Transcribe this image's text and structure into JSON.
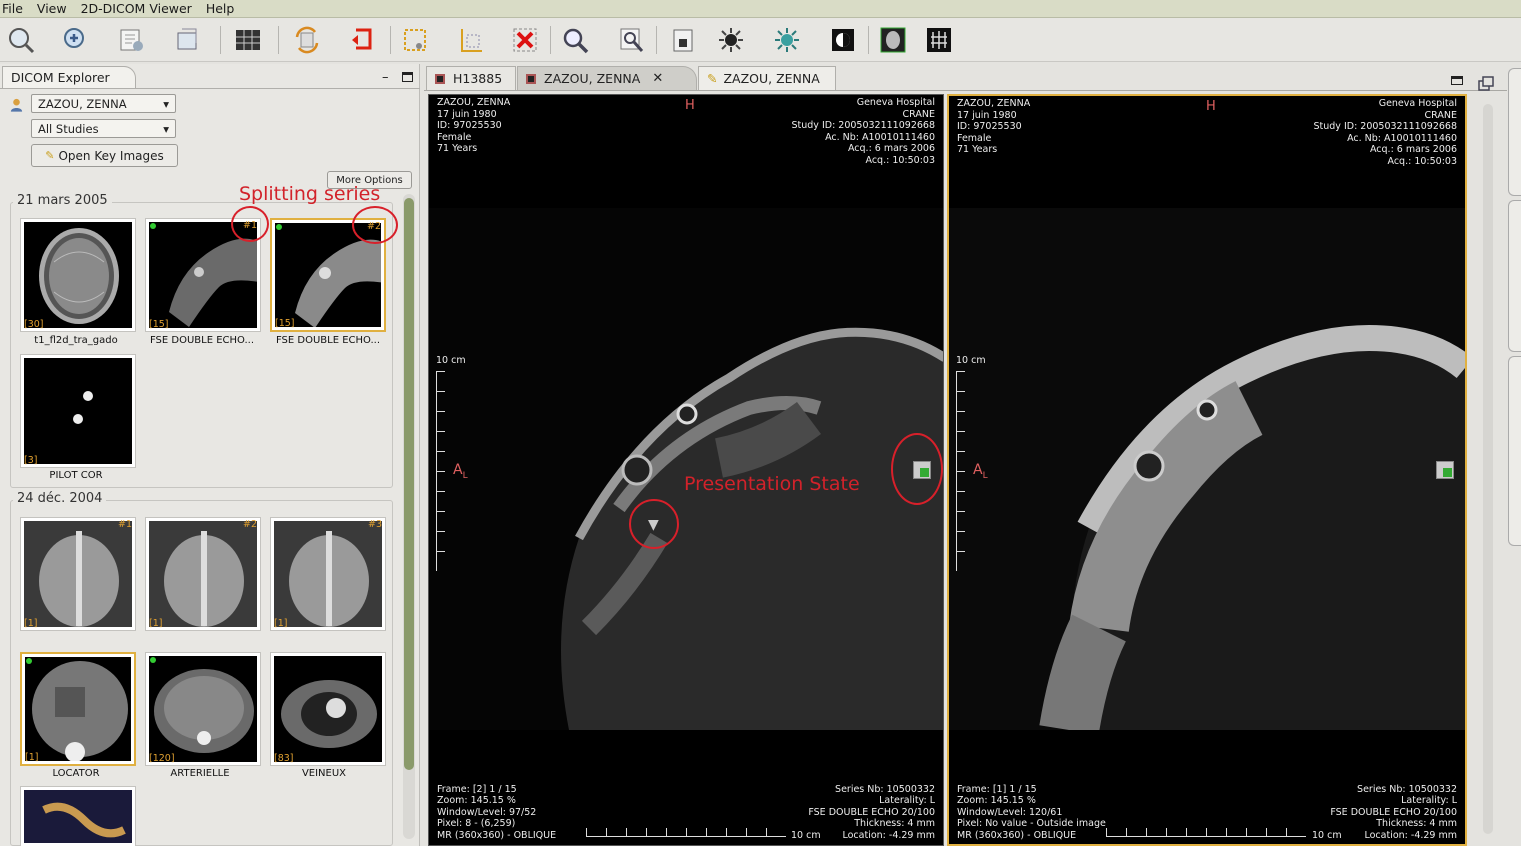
{
  "menu": [
    "File",
    "View",
    "2D-DICOM Viewer",
    "Help"
  ],
  "explorer": {
    "tab_title": "DICOM Explorer",
    "patient_select": "ZAZOU, ZENNA",
    "studies_select": "All Studies",
    "open_key_images": "Open Key Images",
    "more_options": "More Options",
    "study1": {
      "date": "21 mars 2005",
      "series": [
        {
          "label": "t1_fl2d_tra_gado",
          "count": "[30]",
          "num": ""
        },
        {
          "label": "FSE DOUBLE ECHO...",
          "count": "[15]",
          "num": "#1"
        },
        {
          "label": "FSE DOUBLE ECHO...",
          "count": "[15]",
          "num": "#2"
        },
        {
          "label": "PILOT COR",
          "count": "[3]",
          "num": ""
        }
      ]
    },
    "study2": {
      "date": "24 déc. 2004",
      "series": [
        {
          "label": "",
          "count": "[1]",
          "num": "#1"
        },
        {
          "label": "",
          "count": "[1]",
          "num": "#2"
        },
        {
          "label": "",
          "count": "[1]",
          "num": "#3"
        },
        {
          "label": "LOCATOR",
          "count": "[1]",
          "num": ""
        },
        {
          "label": "ARTERIELLE",
          "count": "[120]",
          "num": ""
        },
        {
          "label": "VEINEUX",
          "count": "[83]",
          "num": ""
        }
      ]
    }
  },
  "annotations": {
    "splitting": "Splitting series",
    "presentation": "Presentation State"
  },
  "tabs": [
    "H13885",
    "ZAZOU, ZENNA",
    "ZAZOU, ZENNA"
  ],
  "viewer": {
    "top_left": "ZAZOU, ZENNA\n17 juin 1980\nID: 97025530\nFemale\n71 Years",
    "top_right": "Geneva Hospital\nCRANE\nStudy ID: 2005032111092668\nAc. Nb: A10010111460\nAcq.: 6 mars 2006\nAcq.: 10:50:03",
    "orient_top": "H",
    "orient_left": "A",
    "orient_left_sub": "L",
    "scale_label": "10 cm",
    "scale_bottom": "10 cm",
    "left": {
      "bottom_left": "Frame: [2] 1 / 15\nZoom: 145.15 %\nWindow/Level: 97/52\nPixel: 8 - (6,259)\nMR (360x360) - OBLIQUE",
      "bottom_right": "Series Nb: 10500332\nLaterality: L\nFSE DOUBLE ECHO 20/100\nThickness: 4 mm\nLocation: -4.29 mm"
    },
    "right": {
      "bottom_left": "Frame: [1] 1 / 15\nZoom: 145.15 %\nWindow/Level: 120/61\nPixel: No value - Outside image\nMR (360x360) - OBLIQUE",
      "bottom_right": "Series Nb: 10500332\nLaterality: L\nFSE DOUBLE ECHO 20/100\nThickness: 4 mm\nLocation: -4.29 mm"
    }
  },
  "colors": {
    "accent": "#e0b040",
    "annotation": "#d2222a",
    "overlay_orient": "#e06060"
  }
}
